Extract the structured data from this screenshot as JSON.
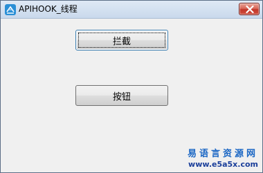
{
  "window": {
    "title": "APIHOOK_线程"
  },
  "titlebar": {
    "app_icon": "app-logo-icon",
    "close_icon": "close-icon",
    "close_color": "#c2362a"
  },
  "buttons": {
    "intercept_label": "拦截",
    "generic_label": "按钮"
  },
  "watermark": {
    "brand": "易语言资源网",
    "url": "www.e5a5x.com"
  }
}
